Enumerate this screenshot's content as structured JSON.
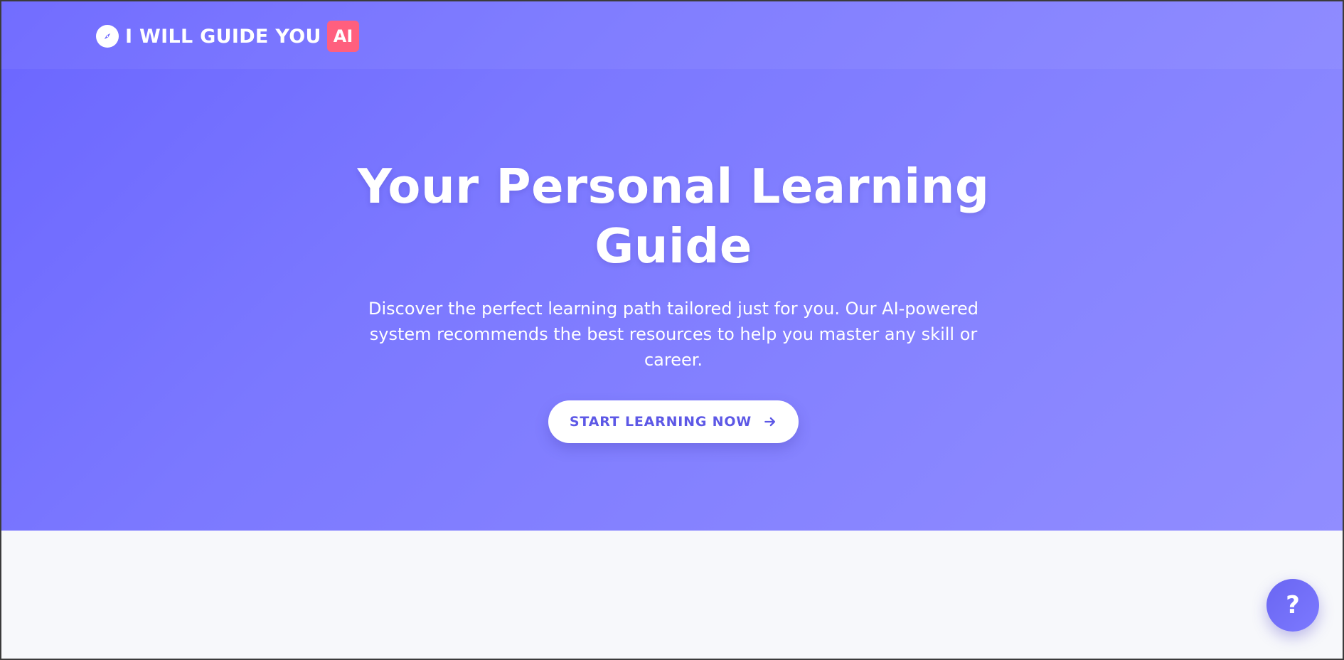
{
  "header": {
    "brand_name": "I WILL GUIDE YOU",
    "brand_badge": "AI",
    "brand_icon": "compass-icon"
  },
  "hero": {
    "title": "Your Personal Learning Guide",
    "subtitle": "Discover the perfect learning path tailored just for you. Our AI-powered system recommends the best resources to help you master any skill or career.",
    "cta_label": "START LEARNING NOW",
    "cta_icon": "arrow-right-icon"
  },
  "help_button": {
    "label": "?",
    "icon": "question-icon"
  },
  "colors": {
    "hero_gradient_start": "#6b66ff",
    "hero_gradient_end": "#918dff",
    "badge": "#ff5f7e",
    "cta_text": "#5d58e6",
    "page_background": "#f7f8fb"
  }
}
